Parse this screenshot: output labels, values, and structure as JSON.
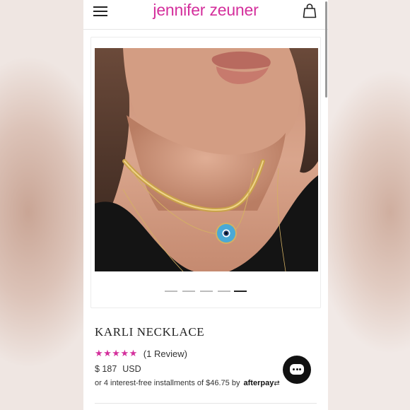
{
  "header": {
    "brand": "jennifer zeuner",
    "menu_icon": "hamburger-menu-icon",
    "cart_icon": "shopping-bag-icon"
  },
  "gallery": {
    "image_subject": "gold-necklace-photo",
    "slide_count": 5,
    "active_slide": 5
  },
  "product": {
    "title": "KARLI NECKLACE",
    "stars": "★★★★★",
    "rating_value": 5,
    "review_text": "(1 Review)",
    "price": "$ 187",
    "currency": "USD",
    "installments_text": "or 4 interest-free installments of $46.75 by",
    "afterpay_label": "afterpay",
    "afterpay_icon": "afterpay-arrows-icon"
  },
  "chat": {
    "icon": "chat-bubble-icon"
  },
  "colors": {
    "brand": "#d42f9c",
    "stars": "#d42f9c",
    "chat_button": "#111111"
  }
}
